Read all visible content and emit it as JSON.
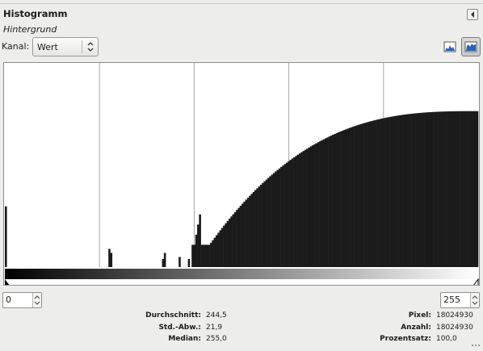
{
  "dialog": {
    "title": "Histogramm",
    "layer_name": "Hintergrund",
    "detach_icon": "detach-tab-icon"
  },
  "channel": {
    "label": "Kanal:",
    "selected": "Wert",
    "icon": "up-down-arrows-icon"
  },
  "scale_buttons": {
    "linear_icon": "linear-histogram-icon",
    "logarithmic_icon": "logarithmic-histogram-icon",
    "active": "logarithmic"
  },
  "range": {
    "low": "0",
    "high": "255"
  },
  "statistics": {
    "left": [
      {
        "label": "Durchschnitt:",
        "value": "244,5"
      },
      {
        "label": "Std.-Abw.:",
        "value": "21,9"
      },
      {
        "label": "Median:",
        "value": "255,0"
      }
    ],
    "right": [
      {
        "label": "Pixel:",
        "value": "18024930"
      },
      {
        "label": "Anzahl:",
        "value": "18024930"
      },
      {
        "label": "Prozentsatz:",
        "value": "100,0"
      }
    ]
  },
  "chart_data": {
    "type": "bar",
    "x_range": [
      0,
      255
    ],
    "grid": "vertical lines at quarters",
    "scale": "logarithmic",
    "description_values": "relative bar heights (0-1) by intensity bin",
    "bins": [
      {
        "x": 0,
        "h": 0.3
      },
      {
        "x": 56,
        "h": 0.09
      },
      {
        "x": 57,
        "h": 0.07
      },
      {
        "x": 85,
        "h": 0.04
      },
      {
        "x": 86,
        "h": 0.07
      },
      {
        "x": 94,
        "h": 0.05
      },
      {
        "x": 99,
        "h": 0.04
      },
      {
        "x": 101,
        "h": 0.11
      }
    ],
    "ramp_start": 102,
    "ramp_end": 255,
    "ramp_max": 0.77
  },
  "colors": {
    "histogram": "#1b1b1b",
    "grid": "#a8a8a8",
    "background": "#ededeb"
  }
}
